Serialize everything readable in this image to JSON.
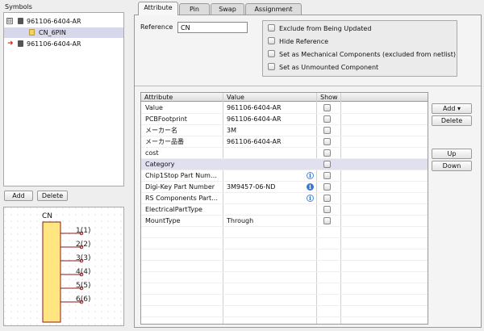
{
  "symbols_panel": {
    "title": "Symbols",
    "tree": [
      {
        "label": "961106-6404-AR",
        "expander": "⊟"
      },
      {
        "label": "CN_6PIN"
      },
      {
        "label": "961106-6404-AR"
      }
    ],
    "add_label": "Add",
    "delete_label": "Delete"
  },
  "preview": {
    "ref": "CN",
    "pins": [
      {
        "num": "1",
        "name": "(1)"
      },
      {
        "num": "2",
        "name": "(2)"
      },
      {
        "num": "3",
        "name": "(3)"
      },
      {
        "num": "4",
        "name": "(4)"
      },
      {
        "num": "5",
        "name": "(5)"
      },
      {
        "num": "6",
        "name": "(6)"
      }
    ],
    "body_color": "#ffe680",
    "outline_color": "#8b1a1a"
  },
  "tabs": [
    "Attribute",
    "Pin",
    "Swap",
    "Assignment"
  ],
  "attribute_tab": {
    "reference_label": "Reference",
    "reference_value": "CN",
    "options": [
      "Exclude from Being Updated",
      "Hide Reference",
      "Set as Mechanical Components (excluded from netlist)",
      "Set as Unmounted Component"
    ],
    "grid_headers": [
      "Attribute",
      "Value",
      "Show"
    ],
    "rows": [
      {
        "attr": "Value",
        "value": "961106-6404-AR",
        "info": ""
      },
      {
        "attr": "PCBFootprint",
        "value": "961106-6404-AR",
        "info": ""
      },
      {
        "attr": "メーカー名",
        "value": "3M",
        "info": ""
      },
      {
        "attr": "メーカー品番",
        "value": "961106-6404-AR",
        "info": ""
      },
      {
        "attr": "cost",
        "value": "",
        "info": ""
      },
      {
        "attr": "Category",
        "value": "",
        "info": ""
      },
      {
        "attr": "Chip1Stop Part Num…",
        "value": "",
        "info": "light"
      },
      {
        "attr": "Digi-Key Part Number",
        "value": "3M9457-06-ND",
        "info": "dark"
      },
      {
        "attr": "RS Components Part…",
        "value": "",
        "info": "light"
      },
      {
        "attr": "ElectricalPartType",
        "value": "",
        "info": ""
      },
      {
        "attr": "MountType",
        "value": "Through",
        "info": ""
      }
    ],
    "buttons": {
      "add": "Add ▾",
      "delete": "Delete",
      "up": "Up",
      "down": "Down"
    }
  },
  "info_glyph": "i",
  "selected_row_color": "#e0e0f0"
}
